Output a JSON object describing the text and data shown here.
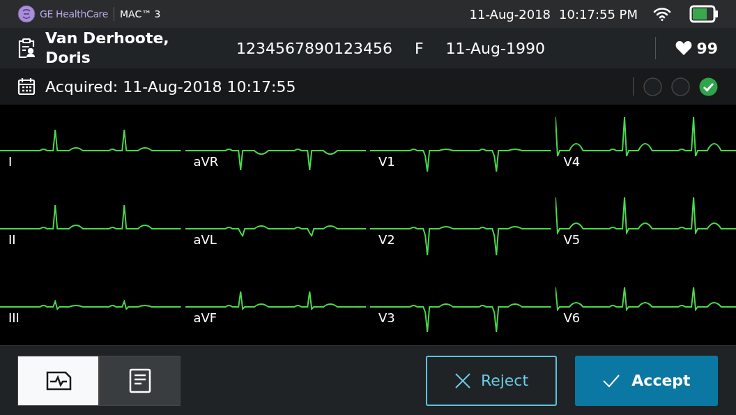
{
  "status_bar": {
    "brand": "GE HealthCare",
    "device": "MAC™ 3",
    "date": "11-Aug-2018",
    "time": "10:17:55 PM"
  },
  "patient": {
    "name": "Van Derhoote, Doris",
    "id": "1234567890123456",
    "sex": "F",
    "birth_date": "11-Aug-1990",
    "heart_rate": "99"
  },
  "acquisition": {
    "text": "Acquired: 11-Aug-2018 10:17:55",
    "steps": [
      {
        "checked": false
      },
      {
        "checked": false
      },
      {
        "checked": true
      }
    ]
  },
  "leads": [
    {
      "label": "I"
    },
    {
      "label": "aVR"
    },
    {
      "label": "V1"
    },
    {
      "label": "V4"
    },
    {
      "label": "II"
    },
    {
      "label": "aVL"
    },
    {
      "label": "V2"
    },
    {
      "label": "V5"
    },
    {
      "label": "III"
    },
    {
      "label": "aVF"
    },
    {
      "label": "V3"
    },
    {
      "label": "V6"
    }
  ],
  "view_tabs": [
    {
      "kind": "waveform",
      "selected": true
    },
    {
      "kind": "report",
      "selected": false
    }
  ],
  "buttons": [
    {
      "kind": "reject",
      "label": "Reject"
    },
    {
      "kind": "accept",
      "label": "Accept"
    }
  ]
}
